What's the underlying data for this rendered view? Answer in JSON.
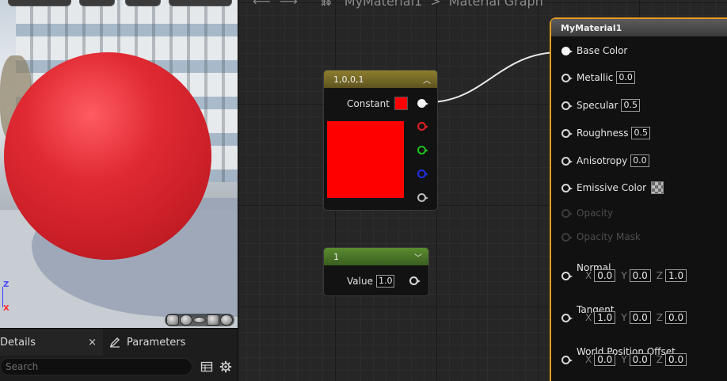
{
  "graph": {
    "breadcrumb": {
      "material_name": "MyMaterial1",
      "separator": ">",
      "graph_name": "Material Graph"
    }
  },
  "constant_node": {
    "title": "1,0,0,1",
    "label": "Constant",
    "color": "#ff0000"
  },
  "scalar_node": {
    "title": "1",
    "label": "Value",
    "value": "1.0"
  },
  "material_node": {
    "title": "MyMaterial1",
    "inputs": [
      {
        "label": "Base Color"
      },
      {
        "label": "Metallic",
        "value": "0.0"
      },
      {
        "label": "Specular",
        "value": "0.5"
      },
      {
        "label": "Roughness",
        "value": "0.5"
      },
      {
        "label": "Anisotropy",
        "value": "0.0"
      },
      {
        "label": "Emissive Color"
      },
      {
        "label": "Opacity"
      },
      {
        "label": "Opacity Mask"
      },
      {
        "label": "Normal",
        "x": "0.0",
        "y": "0.0",
        "z": "1.0"
      },
      {
        "label": "Tangent",
        "x": "1.0",
        "y": "0.0",
        "z": "0.0"
      },
      {
        "label": "World Position Offset",
        "x": "0.0",
        "y": "0.0",
        "z": "0.0"
      }
    ],
    "axis_labels": {
      "x": "X",
      "y": "Y",
      "z": "Z"
    }
  },
  "viewport": {
    "axis_z": "Z",
    "axis_x": "X"
  },
  "details_panel": {
    "tabs": [
      {
        "label": "Details",
        "close": "×"
      },
      {
        "label": "Parameters"
      }
    ],
    "search_placeholder": "Search"
  },
  "colors": {
    "accent_selected": "#e59a1f",
    "constant_header": "#8d7e2e",
    "scalar_header": "#5b8b2f"
  }
}
